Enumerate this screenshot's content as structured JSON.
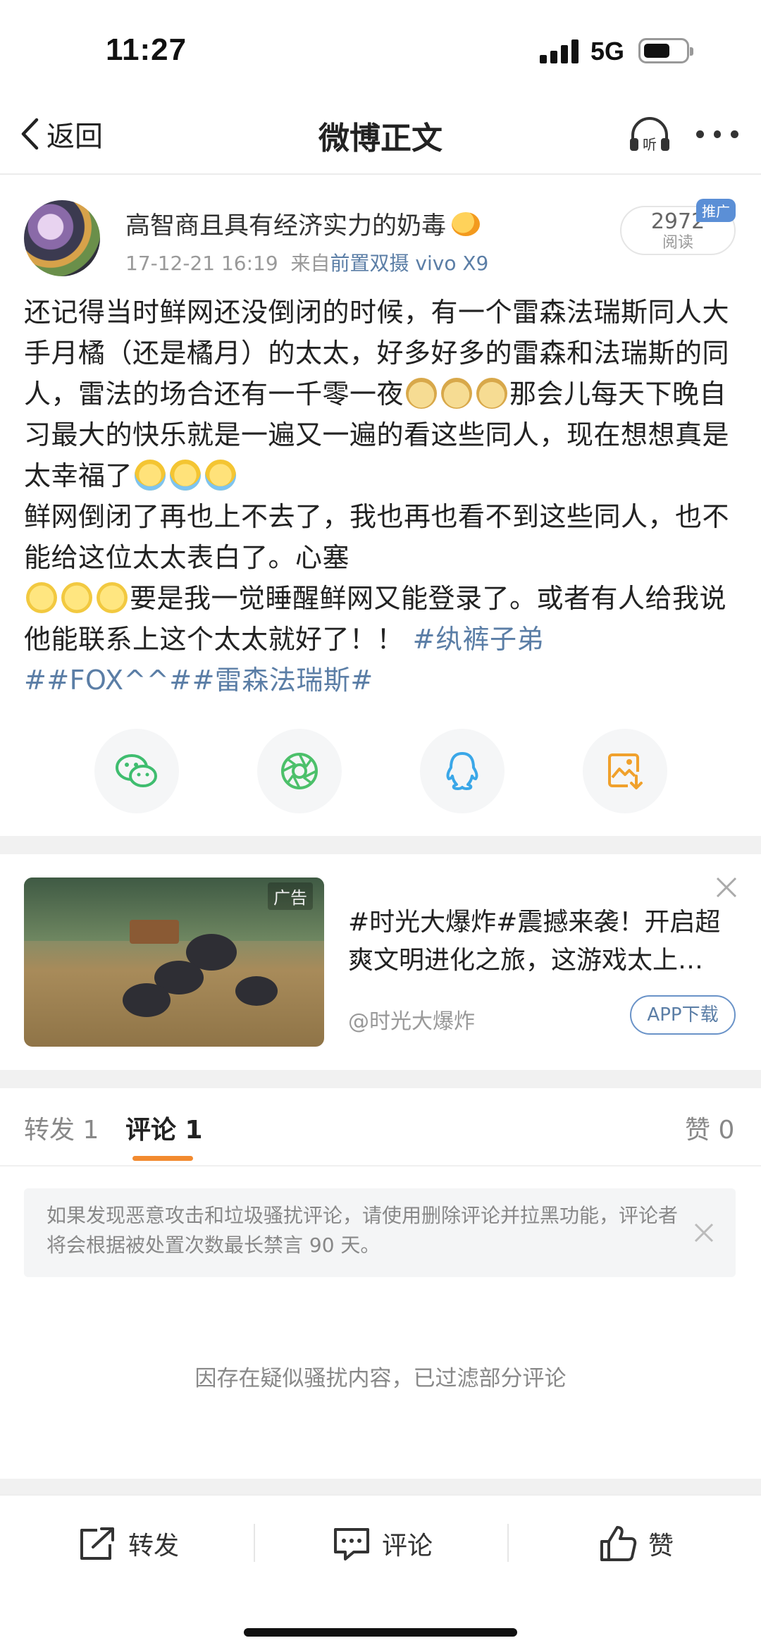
{
  "status": {
    "time": "11:27",
    "network": "5G"
  },
  "nav": {
    "back_label": "返回",
    "title": "微博正文"
  },
  "post": {
    "author": "高智商且具有经济实力的奶毒",
    "time": "17-12-21 16:19",
    "source_prefix": "来自",
    "source": "前置双摄 vivo X9",
    "read_count": "2972",
    "read_label": "阅读",
    "promo_badge": "推广",
    "text": {
      "p1": "还记得当时鲜网还没倒闭的时候，有一个雷森法瑞斯同人大手月橘（还是橘月）的太太，好多好多的雷森和法瑞斯的同人，雷法的场合还有一千零一夜",
      "p1b": "那会儿每天下晚自习最大的快乐就是一遍又一遍的看这些同人，现在想想真是太幸福了",
      "p2": "鲜网倒闭了再也上不去了，我也再也看不到这些同人，也不能给这位太太表白了。心塞",
      "p3": "要是我一觉睡醒鲜网又能登录了。或者有人给我说他能联系上这个太太就好了！！",
      "tag1": "#纨裤子弟",
      "tag2": "##FOX^^##雷森法瑞斯#"
    }
  },
  "share": [
    {
      "icon": "wechat-icon",
      "color": "#3fbd6f"
    },
    {
      "icon": "moments-icon",
      "color": "#4cc06a"
    },
    {
      "icon": "qq-icon",
      "color": "#3aa7e8"
    },
    {
      "icon": "save-image-icon",
      "color": "#f0a12c"
    }
  ],
  "ad": {
    "tag": "广告",
    "title": "#时光大爆炸#震撼来袭！开启超爽文明进化之旅，这游戏太上…",
    "account": "@时光大爆炸",
    "button": "APP下载"
  },
  "tabs": {
    "repost": "转发 1",
    "comment": "评论 1",
    "like": "赞 0"
  },
  "notice": "如果发现恶意攻击和垃圾骚扰评论，请使用删除评论并拉黑功能，评论者将会根据被处置次数最长禁言 90 天。",
  "filtered_notice": "因存在疑似骚扰内容，已过滤部分评论",
  "bottom": {
    "repost": "转发",
    "comment": "评论",
    "like": "赞"
  },
  "colors": {
    "link": "#5b7ea6",
    "accent": "#f28a2f"
  }
}
